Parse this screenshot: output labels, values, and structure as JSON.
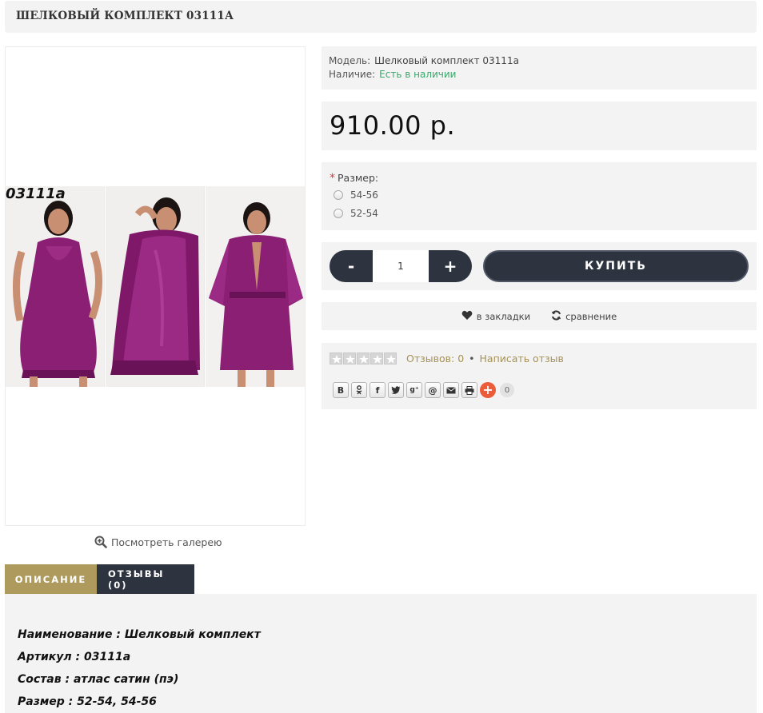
{
  "page": {
    "title": "ШЕЛКОВЫЙ КОМПЛЕКТ 03111А"
  },
  "image": {
    "sku_label": "03111a",
    "gallery_link": "Посмотреть галерею"
  },
  "info": {
    "model_label": "Модель:",
    "model_value": "Шелковый комплект 03111а",
    "availability_label": "Наличие:",
    "availability_value": "Есть в наличии"
  },
  "price": "910.00 р.",
  "options": {
    "required_mark": "*",
    "size_label": "Размер:",
    "sizes": [
      "54-56",
      "52-54"
    ]
  },
  "cart": {
    "minus": "-",
    "plus": "+",
    "quantity": "1",
    "buy_label": "КУПИТЬ"
  },
  "actions": {
    "wishlist": "в закладки",
    "compare": "сравнение"
  },
  "reviews": {
    "rating": 0,
    "count_text": "Отзывов: 0",
    "separator": "•",
    "write_review": "Написать отзыв"
  },
  "share": {
    "buttons": [
      "vk",
      "odnoklassniki",
      "facebook",
      "twitter",
      "google-plus",
      "mailru",
      "email",
      "print"
    ],
    "count": "0"
  },
  "tabs": {
    "description": "ОПИСАНИЕ",
    "reviews": "ОТЗЫВЫ (0)"
  },
  "description": {
    "lines": [
      "Наименование : Шелковый комплект",
      "Артикул : 03111а",
      "Состав : атлас сатин (пэ)",
      "Размер : 52-54, 54-56"
    ]
  },
  "colors": {
    "dark": "#2e3340",
    "gold": "#ad9a5c",
    "stock_green": "#3aa66a",
    "panel_bg": "#f3f3f3",
    "dress_purple": "#8a1f73"
  }
}
